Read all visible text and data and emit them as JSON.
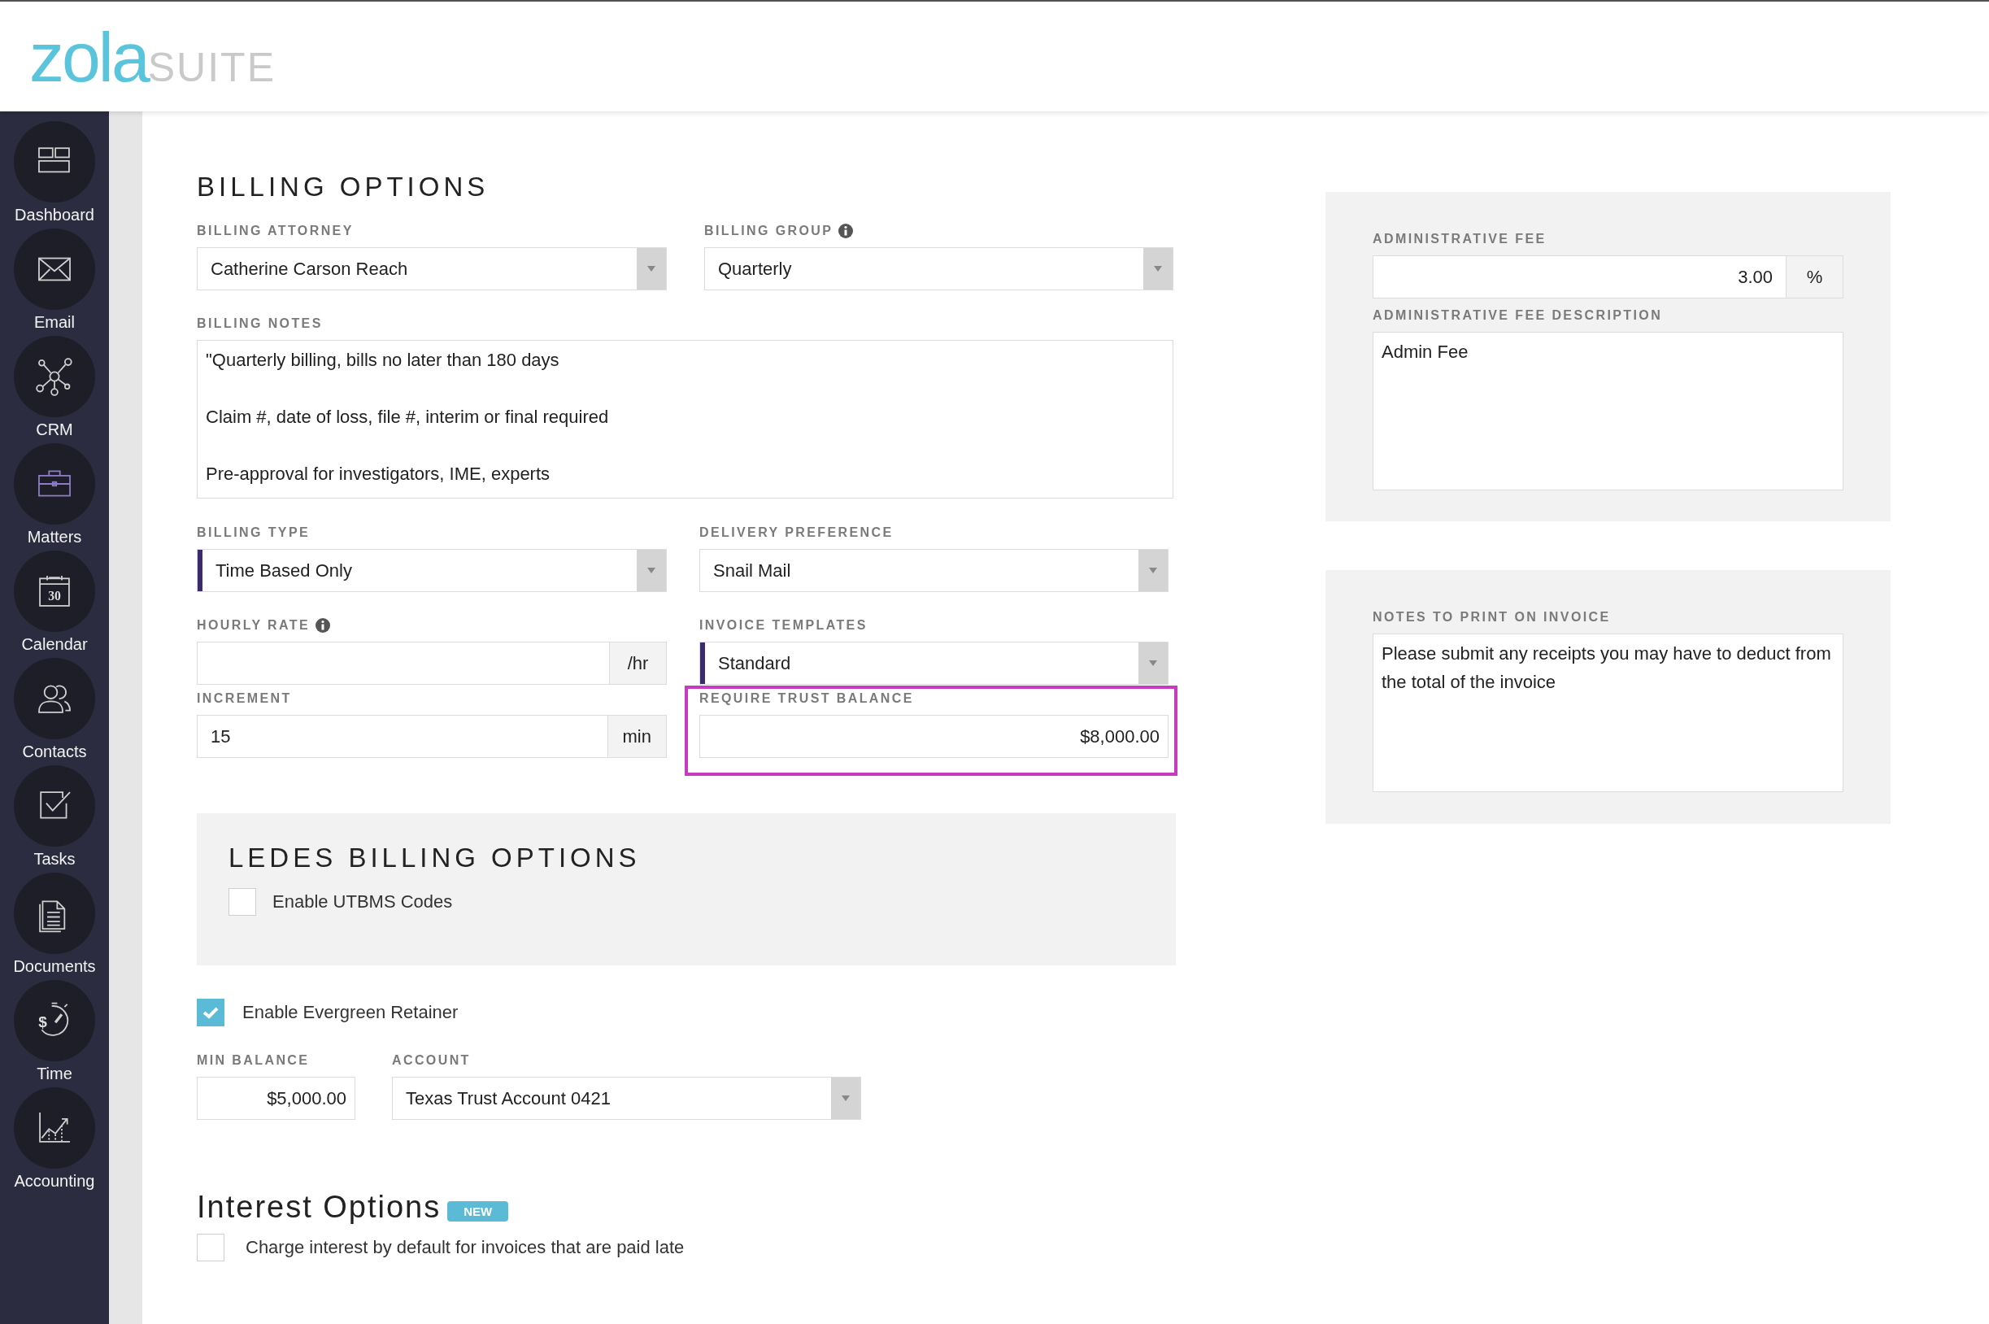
{
  "logo": {
    "name": "zola",
    "suffix": "SUITE"
  },
  "sidebar": {
    "items": [
      {
        "label": "Dashboard",
        "selected": false
      },
      {
        "label": "Email",
        "selected": false
      },
      {
        "label": "CRM",
        "selected": false
      },
      {
        "label": "Matters",
        "selected": true
      },
      {
        "label": "Calendar",
        "icon_text": "30",
        "selected": false
      },
      {
        "label": "Contacts",
        "selected": false
      },
      {
        "label": "Tasks",
        "selected": false
      },
      {
        "label": "Documents",
        "selected": false
      },
      {
        "label": "Time",
        "icon_text": "$",
        "selected": false
      },
      {
        "label": "Accounting",
        "selected": false
      }
    ]
  },
  "billing_options": {
    "title": "BILLING OPTIONS",
    "billing_attorney": {
      "kind": "select",
      "label": "BILLING ATTORNEY",
      "value": "Catherine Carson Reach"
    },
    "billing_group": {
      "kind": "select",
      "label": "BILLING GROUP",
      "value": "Quarterly",
      "info": true
    },
    "billing_notes": {
      "kind": "textarea",
      "label": "BILLING NOTES",
      "value": "\"Quarterly billing, bills no later than 180 days\n\nClaim #, date of loss, file #, interim or final required\n\nPre-approval for investigators, IME, experts"
    },
    "billing_type": {
      "kind": "select",
      "label": "BILLING TYPE",
      "value": "Time Based Only",
      "accent": true
    },
    "delivery_preference": {
      "kind": "select",
      "label": "DELIVERY PREFERENCE",
      "value": "Snail Mail"
    },
    "hourly_rate": {
      "kind": "addon",
      "label": "HOURLY RATE",
      "addon": "/hr",
      "info": true
    },
    "invoice_templates": {
      "kind": "select",
      "label": "INVOICE TEMPLATES",
      "value": "Standard",
      "accent": true
    },
    "increment": {
      "kind": "addon",
      "label": "INCREMENT",
      "value": "15",
      "addon": "min"
    },
    "require_trust_balance": {
      "kind": "amount",
      "label": "REQUIRE TRUST BALANCE",
      "value": "$8,000.00",
      "outlined": true
    }
  },
  "ledes": {
    "title": "LEDES BILLING OPTIONS",
    "option": {
      "label": "Enable UTBMS Codes",
      "checked": false
    }
  },
  "evergreen": {
    "option": {
      "label": "Enable Evergreen Retainer",
      "checked": true
    },
    "min_balance": {
      "kind": "amount",
      "label": "MIN BALANCE",
      "value": "$5,000.00"
    },
    "account": {
      "kind": "select",
      "label": "ACCOUNT",
      "value": "Texas Trust Account 0421"
    }
  },
  "interest": {
    "title": "Interest Options",
    "badge": "NEW",
    "option": {
      "label": "Charge interest by default for invoices that are paid late",
      "checked": false
    }
  },
  "admin_panel": {
    "administrative_fee": {
      "kind": "addon_right",
      "label": "ADMINISTRATIVE FEE",
      "value": "3.00",
      "addon": "%"
    },
    "description": {
      "kind": "textarea",
      "label": "ADMINISTRATIVE FEE DESCRIPTION",
      "value": "Admin Fee"
    }
  },
  "invoice_notes_panel": {
    "notes": {
      "kind": "textarea",
      "label": "NOTES TO PRINT ON INVOICE",
      "value": "Please submit any receipts you may have to deduct from the total of the invoice"
    }
  }
}
